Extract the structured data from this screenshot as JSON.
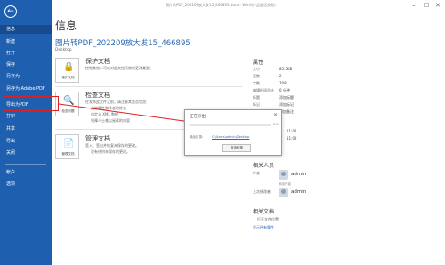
{
  "window": {
    "title": "图片转PDF_202209放大发15_466895.docx - Word(产品激活失败)",
    "min": "–",
    "max": "☐",
    "close": "✕"
  },
  "sidebar": {
    "back": "←",
    "items": [
      {
        "label": "信息"
      },
      {
        "label": "新建"
      },
      {
        "label": "打开"
      },
      {
        "label": "保存"
      },
      {
        "label": "另存为"
      },
      {
        "label": "另存为 Adobe PDF"
      },
      {
        "label": "导出为PDF"
      },
      {
        "label": "打印"
      },
      {
        "label": "共享"
      },
      {
        "label": "导出"
      },
      {
        "label": "关闭"
      },
      {
        "label": "帐户"
      },
      {
        "label": "选项"
      }
    ]
  },
  "main": {
    "page_title": "信息",
    "doc_title": "图片转PDF_202209放大发15_466895",
    "doc_location": "Desktop",
    "sections": [
      {
        "tile_label": "保护文档",
        "title": "保护文档",
        "lines": [
          "控制其他人可以对此文档所做的更改类型。"
        ]
      },
      {
        "tile_label": "检查问题",
        "title": "检查文档",
        "lines": [
          "在发布此文件之前，请注意其是否包含:",
          "文档属性和作者的姓名",
          "自定义 XML 数据",
          "残障人士难以阅读的内容"
        ]
      },
      {
        "tile_label": "管理文档",
        "title": "管理文档",
        "lines": [
          "签入、签出并恢复未保存的更改。",
          "没有任何未保存的更改。"
        ]
      }
    ]
  },
  "properties": {
    "title": "属性",
    "rows": [
      {
        "label": "大小",
        "value": "85.5KB"
      },
      {
        "label": "页数",
        "value": "2"
      },
      {
        "label": "字数",
        "value": "708"
      },
      {
        "label": "编辑时间总计",
        "value": "0 分钟"
      },
      {
        "label": "标题",
        "value": "添加标题"
      },
      {
        "label": "标记",
        "value": "添加标记"
      },
      {
        "label": "备注",
        "value": "添加备注"
      }
    ],
    "dates_partial": [
      {
        "value": "11:02"
      },
      {
        "value": "11:02"
      }
    ],
    "related_people_title": "相关人员",
    "author_label": "作者",
    "author_name": "admin",
    "add_author": "添加作者",
    "last_modified_label": "上次修改者",
    "last_modified_name": "admin",
    "related_docs_title": "相关文档",
    "open_location": "打开文件位置",
    "show_all": "显示所有属性"
  },
  "dialog": {
    "title": "正在导出",
    "close": "✕",
    "percent": "0%",
    "path_label": "输出目录:",
    "path": "C:\\Users\\admin\\Desktop",
    "cancel": "取消转换"
  },
  "colors": {
    "sidebar": "#1f5fb0",
    "accent": "#2a6ab8",
    "annotation": "#e02020"
  }
}
